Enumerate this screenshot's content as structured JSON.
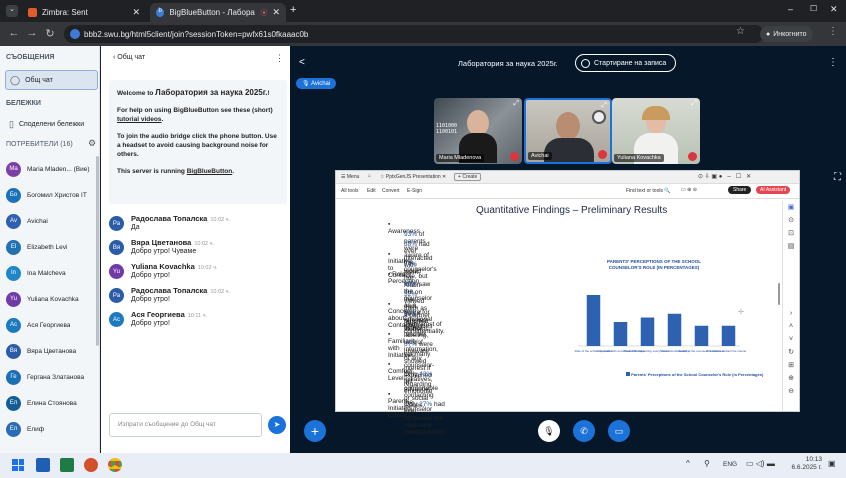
{
  "browser": {
    "tabs": [
      {
        "label": "Zimbra: Sent"
      },
      {
        "label": "BigBlueButton - Лаборатор"
      }
    ],
    "url": "bbb2.swu.bg/html5client/join?sessionToken=pwfx61s0fkaaac0b",
    "incognito_label": "Инкогнито"
  },
  "sidebar": {
    "messages_header": "СЪОБЩЕНИЯ",
    "public_chat": "Общ чат",
    "notes_header": "БЕЛЕЖКИ",
    "shared_notes": "Споделени бележки",
    "users_header": "ПОТРЕБИТЕЛИ (16)",
    "users": [
      {
        "initials": "Ma",
        "name": "Maria Mladen... (Вие)",
        "color": "#7b3fa6"
      },
      {
        "initials": "Бо",
        "name": "Богомил Христов IT",
        "color": "#1a73b8"
      },
      {
        "initials": "Av",
        "name": "Avichai",
        "color": "#2e5fb0"
      },
      {
        "initials": "El",
        "name": "Elizabeth Levi",
        "color": "#2271b3"
      },
      {
        "initials": "In",
        "name": "Ina Malcheva",
        "color": "#1f86c9"
      },
      {
        "initials": "Yu",
        "name": "Yuliana Kovachka",
        "color": "#6e3ba8"
      },
      {
        "initials": "Ас",
        "name": "Ася Георгиева",
        "color": "#1d7ac0"
      },
      {
        "initials": "Вя",
        "name": "Вяра Цветанова",
        "color": "#2a5ca8"
      },
      {
        "initials": "Ге",
        "name": "Гергана Златанова",
        "color": "#1b6fb5"
      },
      {
        "initials": "Ел",
        "name": "Елина Стоянова",
        "color": "#145d96"
      },
      {
        "initials": "Ел",
        "name": "Елиф",
        "color": "#2a6db5"
      }
    ]
  },
  "chat": {
    "back_label": "Общ чат",
    "welcome_prefix": "Welcome to ",
    "welcome_bold": "Лаборатория за наука 2025г.",
    "welcome_suffix": "!",
    "help_text": "For help on using BigBlueButton see these (short) ",
    "help_link": "tutorial videos",
    "audio_text": "To join the audio bridge click the phone button. Use a headset to avoid causing background noise for others.",
    "server_text": "This server is running ",
    "server_link": "BigBlueButton",
    "messages": [
      {
        "initials": "Ра",
        "name": "Радослава Топалска",
        "time": "10:02 ч.",
        "text": "Да",
        "color": "#2a5ca8"
      },
      {
        "initials": "Вя",
        "name": "Вяра Цветанова",
        "time": "10:02 ч.",
        "text": "Добро утро! Чуваме",
        "color": "#2a5ca8"
      },
      {
        "initials": "Yu",
        "name": "Yuliana Kovachka",
        "time": "10:02 ч.",
        "text": "Добро утро!",
        "color": "#6e3ba8"
      },
      {
        "initials": "Ра",
        "name": "Радослава Топалска",
        "time": "10:02 ч.",
        "text": "Добро утро!",
        "color": "#2a5ca8"
      },
      {
        "initials": "Ас",
        "name": "Ася Георгиева",
        "time": "10:11 ч.",
        "text": "Добро утро!",
        "color": "#1d7ac0"
      }
    ],
    "input_placeholder": "Изпрати съобщение до Общ чат"
  },
  "main": {
    "title": "Лаборатория за наука 2025г.",
    "record_label": "Стартиране на записа",
    "presenter_badge": "Avichai",
    "videos": [
      {
        "name": "Maria Mladenova"
      },
      {
        "name": "Avichai"
      },
      {
        "name": "Yuliana Kovachka"
      }
    ],
    "pres_toolbar": {
      "menu": "Menu",
      "file": "PptxGenJS Presentation",
      "create": "Create",
      "all_tools": "All tools",
      "edit": "Edit",
      "convert": "Convert",
      "esign": "E-Sign",
      "find": "Find text or tools",
      "share": "Share",
      "assistant": "AI Assistant"
    },
    "slide": {
      "title": "Quantitative Findings – Preliminary Results",
      "bullets": [
        {
          "head": "Awareness",
          "lines": [
            {
              "hl": "93%",
              "rest": " of parents were aware of the counselor's role, but only "
            },
            {
              "hl": "38%",
              "rest": " had ever interacted with them."
            }
          ]
        },
        {
          "head": "Initiative to Contact",
          "lines": [
            {
              "hl": "74%",
              "rest": " would not reach out on their own, only if referred by a teacher."
            }
          ]
        },
        {
          "head": "Role Perception",
          "lines": [
            {
              "hl": "68%",
              "rest": " saw the counselor as a figure for emotional difficulties"
            },
            {
              "hl": "32%",
              "rest": " viewed them as a partner for all students."
            }
          ]
        },
        {
          "head": "Concerns about Contacting",
          "lines": [
            {
              "hl": "57%",
              "rest": " reported fear of labeling, lack of information,"
            },
            {
              "hl": "",
              "rest": "or mistrust of confidentiality."
            }
          ]
        },
        {
          "head": "Familiarity with Initiatives",
          "lines": [
            {
              "hl": "67%",
              "rest": " were unaware of any counselor-led initiatives,"
            },
            {
              "hl": "",
              "rest": "yet many showed interest if explained in advance."
            }
          ]
        },
        {
          "head": "Comfort Level",
          "lines": [
            {
              "hl": "",
              "rest": "Only "
            },
            {
              "hl": "43%",
              "rest": " felt comfortable contacting the counselor"
            },
            {
              "hl": "",
              "rest": "regarding emotional or social issues."
            }
          ]
        },
        {
          "head": "Parent-Initiated Contact",
          "lines": [
            {
              "hl": "",
              "rest": "Only "
            },
            {
              "hl": "27%",
              "rest": " had ever contacted the counselor independently."
            }
          ]
        }
      ]
    }
  },
  "chart_data": {
    "type": "bar",
    "title": "PARENTS' PERCEPTIONS OF THE SCHOOL COUNSELOR'S ROLE (IN PERCENTAGES)",
    "legend": "Parents' Perceptions of the School Counselor's Role (in Percentages)",
    "categories": [
      "Role of the school counselor",
      "Only deals with emotional difficulties",
      "Partner in supporting every student",
      "Trust in confidentiality",
      "Aware of the counselor's initiatives",
      "Initiative to contact the counselor"
    ],
    "values": [
      68,
      32,
      38,
      43,
      27,
      27
    ],
    "ylim": [
      0,
      80
    ],
    "color": "#2e62b0"
  },
  "taskbar": {
    "lang": "ENG",
    "time": "10:13",
    "date": "6.6.2025 г."
  }
}
